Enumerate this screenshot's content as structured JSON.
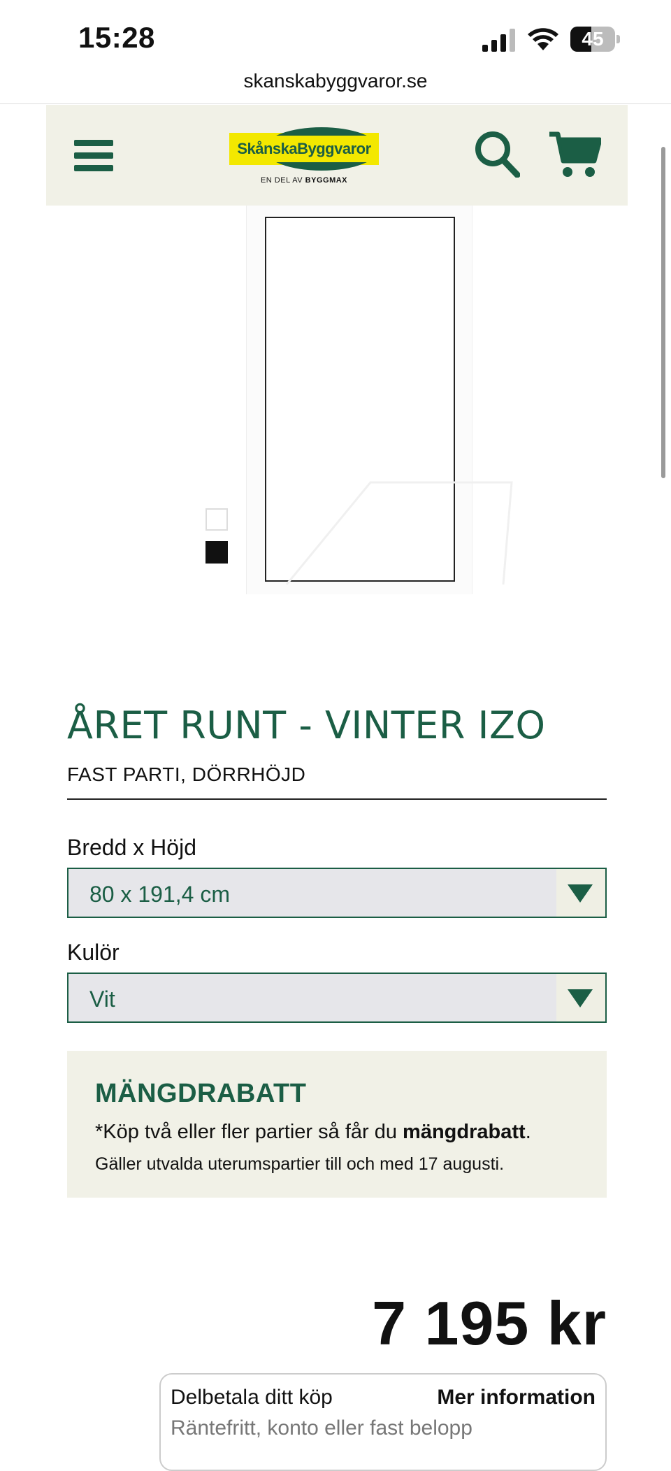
{
  "status_bar": {
    "time": "15:28",
    "battery": "45"
  },
  "browser": {
    "url": "skanskabyggvaror.se"
  },
  "header": {
    "logo_text": "SkånskaByggvaror",
    "logo_sub_prefix": "EN DEL AV ",
    "logo_sub_brand": "BYGGMAX"
  },
  "product": {
    "title": "ÅRET RUNT - VINTER IZO",
    "subtitle": "FAST PARTI, DÖRRHÖJD",
    "size_label": "Bredd x Höjd",
    "size_value": "80 x 191,4 cm",
    "color_label": "Kulör",
    "color_value": "Vit",
    "swatches": [
      "white",
      "black"
    ]
  },
  "discount": {
    "title": "MÄNGDRABATT",
    "text_prefix": "*Köp två eller fler partier så får du ",
    "text_bold": "mängdrabatt",
    "text_suffix": ".",
    "note": "Gäller utvalda uterumspartier till och med 17 augusti."
  },
  "price": {
    "amount": "7 195 kr"
  },
  "finance": {
    "title": "Delbetala ditt köp",
    "link": "Mer information",
    "subtitle": "Räntefritt, konto eller fast belopp"
  },
  "colors": {
    "brand_green": "#1b5e45",
    "brand_yellow": "#f3e800",
    "header_bg": "#f1f1e7"
  }
}
